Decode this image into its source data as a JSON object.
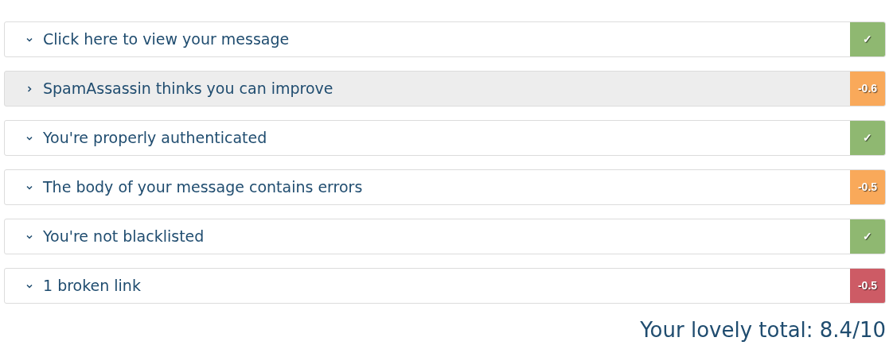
{
  "sections": [
    {
      "title": "Click here to view your message",
      "expanded": true,
      "highlighted": false,
      "score": "✓",
      "color": "#8fb871"
    },
    {
      "title": "SpamAssassin thinks you can improve",
      "expanded": false,
      "highlighted": true,
      "score": "-0.6",
      "color": "#f9a95a"
    },
    {
      "title": "You're properly authenticated",
      "expanded": true,
      "highlighted": false,
      "score": "✓",
      "color": "#8fb871"
    },
    {
      "title": "The body of your message contains errors",
      "expanded": true,
      "highlighted": false,
      "score": "-0.5",
      "color": "#f9a95a"
    },
    {
      "title": "You're not blacklisted",
      "expanded": true,
      "highlighted": false,
      "score": "✓",
      "color": "#8fb871"
    },
    {
      "title": "1 broken link",
      "expanded": true,
      "highlighted": false,
      "score": "-0.5",
      "color": "#cd5b65"
    }
  ],
  "total": "Your lovely total: 8.4/10"
}
